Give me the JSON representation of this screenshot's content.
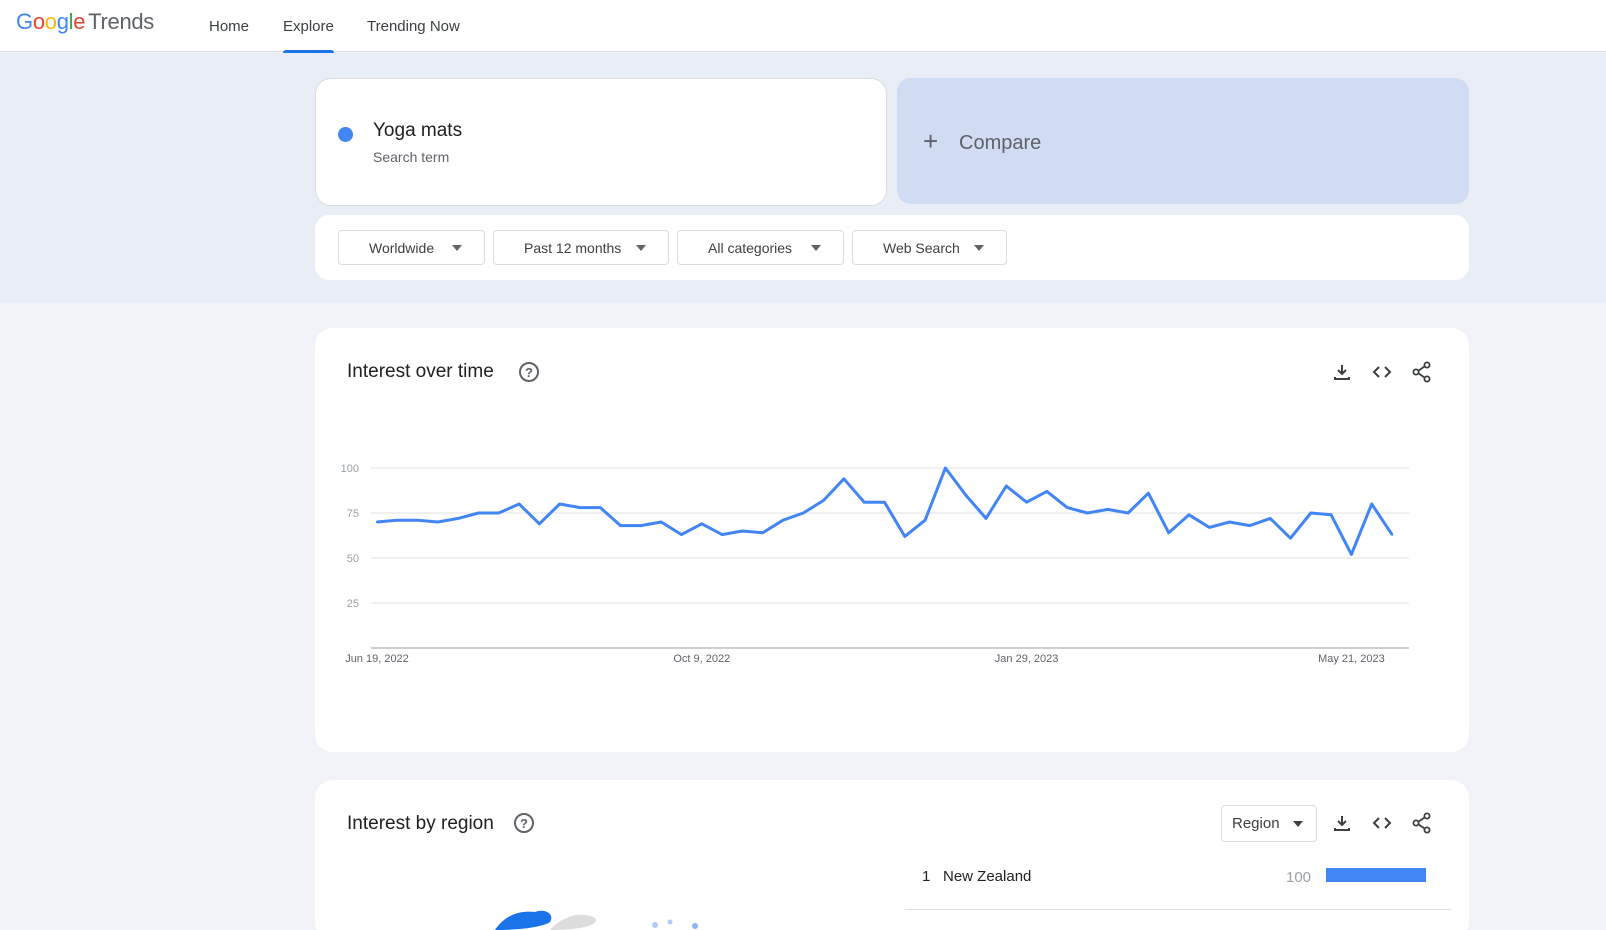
{
  "header": {
    "logo": {
      "google": "Google",
      "trends": "Trends"
    },
    "nav": [
      {
        "label": "Home",
        "active": false
      },
      {
        "label": "Explore",
        "active": true
      },
      {
        "label": "Trending Now",
        "active": false
      }
    ]
  },
  "search_term": {
    "name": "Yoga mats",
    "subtitle": "Search term",
    "color": "#4285f4"
  },
  "compare": {
    "label": "Compare",
    "icon": "plus-icon"
  },
  "filters": [
    {
      "label": "Worldwide"
    },
    {
      "label": "Past 12 months"
    },
    {
      "label": "All categories"
    },
    {
      "label": "Web Search"
    }
  ],
  "interest_over_time": {
    "title": "Interest over time",
    "actions": [
      "download-icon",
      "embed-icon",
      "share-icon"
    ]
  },
  "interest_by_region": {
    "title": "Interest by region",
    "resolution": "Region",
    "actions": [
      "download-icon",
      "embed-icon",
      "share-icon"
    ],
    "rows": [
      {
        "rank": "1",
        "name": "New Zealand",
        "value": "100",
        "fraction": 1.0
      }
    ]
  },
  "chart_data": {
    "type": "line",
    "title": "",
    "xlabel": "",
    "ylabel": "",
    "ylim": [
      0,
      100
    ],
    "grid": true,
    "yticks": [
      "100",
      "75",
      "50",
      "25"
    ],
    "ytick_values": [
      100,
      75,
      50,
      25
    ],
    "xticks": [
      "Jun 19, 2022",
      "Oct 9, 2022",
      "Jan 29, 2023",
      "May 21, 2023"
    ],
    "xtick_index": [
      0,
      16,
      32,
      48
    ],
    "series": [
      {
        "color": "#4285f4",
        "values": [
          70,
          71,
          71,
          70,
          72,
          75,
          75,
          80,
          69,
          80,
          78,
          78,
          68,
          68,
          70,
          63,
          69,
          63,
          65,
          64,
          71,
          75,
          82,
          94,
          81,
          81,
          62,
          71,
          100,
          85,
          72,
          90,
          81,
          87,
          78,
          75,
          77,
          75,
          86,
          64,
          74,
          67,
          70,
          68,
          72,
          61,
          75,
          74,
          52,
          80,
          63
        ]
      }
    ]
  }
}
